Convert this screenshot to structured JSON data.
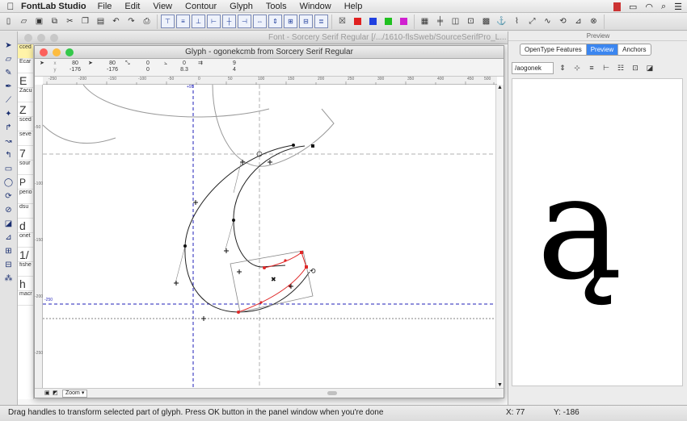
{
  "menubar": {
    "app_name": "FontLab Studio",
    "menus": [
      "File",
      "Edit",
      "View",
      "Contour",
      "Glyph",
      "Tools",
      "Window",
      "Help"
    ]
  },
  "font_window": {
    "title": "Font - Sorcery Serif Regular [/.../1610-flsSweb/SourceSerifPro_L...",
    "cells": [
      "cced",
      "Ecar",
      "E",
      "Zacu",
      "Z",
      "sced",
      "seve",
      "7",
      "sour",
      "P",
      "perio",
      "dsu",
      "d",
      "onet",
      "1/",
      "fishe",
      "h",
      "macr"
    ]
  },
  "glyph_window": {
    "title": "Glyph - ogonekcmb from Sorcery Serif Regular",
    "info": [
      {
        "top": "80",
        "bottom": "-176"
      },
      {
        "top": "80",
        "bottom": "-176"
      },
      {
        "top": "0",
        "bottom": "0"
      },
      {
        "top": "0",
        "bottom": "8.3"
      },
      {
        "top": "9",
        "bottom": "4"
      }
    ],
    "ruler_ticks": [
      "-250",
      "-200",
      "-150",
      "-100",
      "-50",
      "0",
      "50",
      "100",
      "150",
      "200",
      "250",
      "300",
      "350",
      "400",
      "450",
      "500"
    ],
    "left_ruler_ticks": [
      "-50",
      "-100",
      "-150",
      "-200",
      "-250"
    ],
    "guide_labels": {
      "top": "+95",
      "left_top": "-250",
      "bottom": "-250"
    },
    "zoom_label": "Zoom"
  },
  "preview_panel": {
    "title": "Preview",
    "tabs": [
      "OpenType Features",
      "Preview",
      "Anchors"
    ],
    "active_tab": "Preview",
    "text_value": "/aogonek",
    "sample_glyph": "ą"
  },
  "statusbar": {
    "message": "Drag handles to transform selected part of glyph. Press OK button in the panel window when you're done",
    "x_label": "X: 77",
    "y_label": "Y: -186"
  },
  "colors": {
    "accent_blue": "#3b86f0",
    "guide_blue": "#1f1fb8",
    "selection_red": "#e02828",
    "highlight_yellow": "#fff3a8"
  }
}
